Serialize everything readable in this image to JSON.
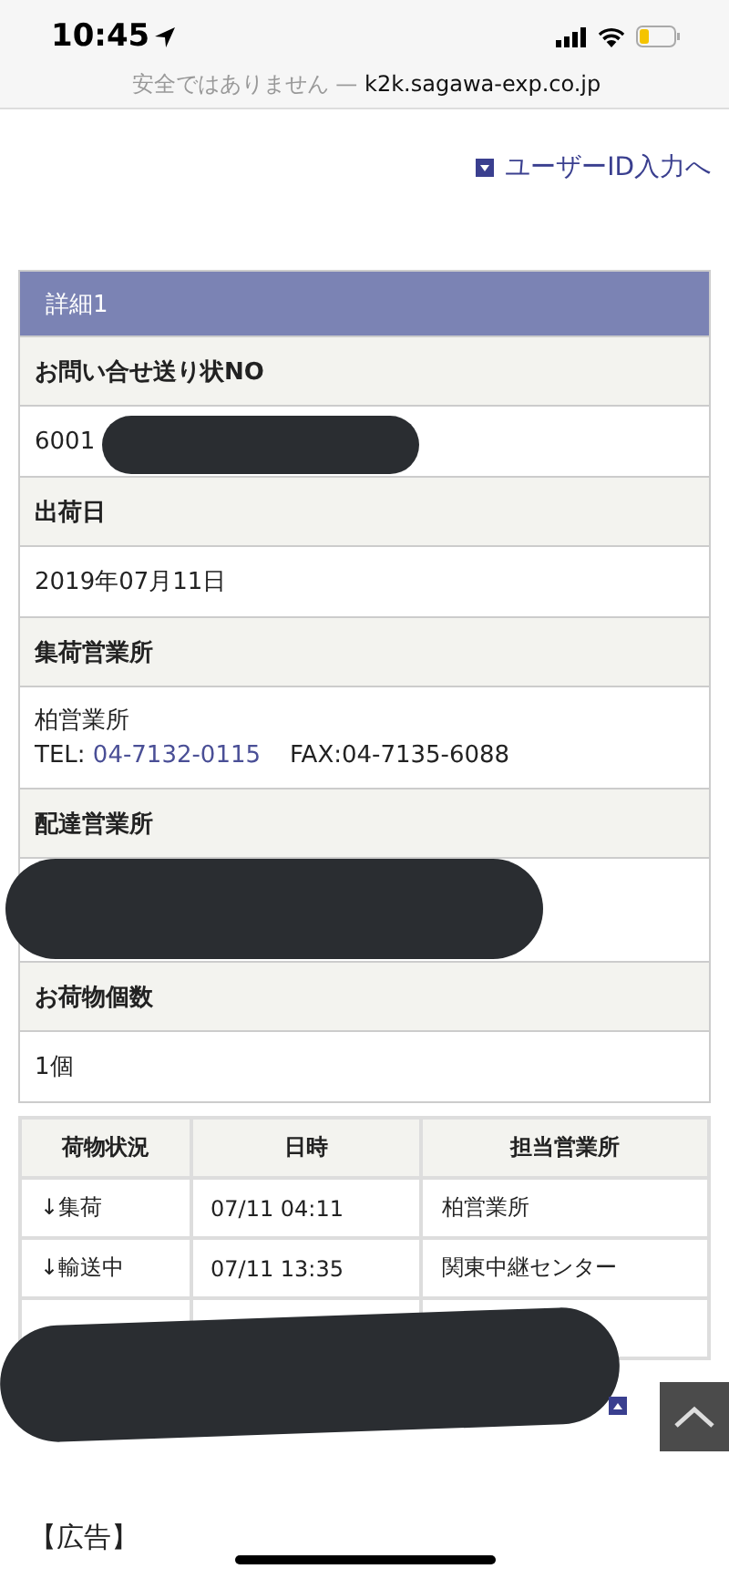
{
  "status_bar": {
    "time": "10:45",
    "security_note": "安全ではありません —",
    "domain": "k2k.sagawa-exp.co.jp"
  },
  "user_id_link": "ユーザーID入力へ",
  "details": {
    "title": "詳細1",
    "fields": [
      {
        "label": "お問い合せ送り状NO",
        "kind": "text",
        "value": "6001",
        "redacted": true
      },
      {
        "label": "出荷日",
        "kind": "text",
        "value": "2019年07月11日"
      },
      {
        "label": "集荷営業所",
        "kind": "office",
        "name": "柏営業所",
        "tel_label": "TEL:",
        "tel": "04-7132-0115",
        "fax": "FAX:04-7135-6088"
      },
      {
        "label": "配達営業所",
        "kind": "blank",
        "redacted": true
      },
      {
        "label": "お荷物個数",
        "kind": "text",
        "value": "1個"
      }
    ]
  },
  "tracking": {
    "columns": [
      "荷物状況",
      "日時",
      "担当営業所"
    ],
    "rows": [
      {
        "cells": [
          "↓集荷",
          "07/11 04:11",
          "柏営業所"
        ]
      },
      {
        "cells": [
          "↓輸送中",
          "07/11 13:35",
          "関東中継センター"
        ]
      },
      {
        "redacted": true
      }
    ]
  },
  "ad_label": "【広告】"
}
